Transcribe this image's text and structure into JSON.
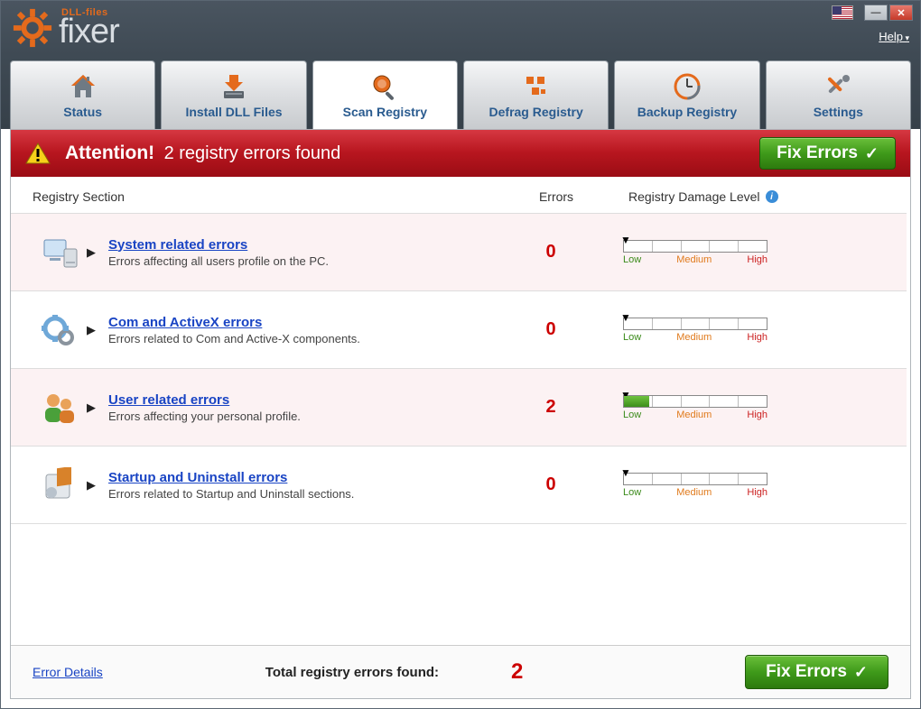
{
  "app": {
    "brand_small": "DLL-files",
    "brand": "fixer",
    "help": "Help"
  },
  "tabs": [
    {
      "label": "Status"
    },
    {
      "label": "Install DLL Files"
    },
    {
      "label": "Scan Registry"
    },
    {
      "label": "Defrag Registry"
    },
    {
      "label": "Backup Registry"
    },
    {
      "label": "Settings"
    }
  ],
  "alert": {
    "attention": "Attention!",
    "message": "2 registry errors found",
    "fix": "Fix Errors"
  },
  "headers": {
    "section": "Registry Section",
    "errors": "Errors",
    "damage": "Registry Damage Level"
  },
  "meter_labels": {
    "low": "Low",
    "med": "Medium",
    "high": "High"
  },
  "rows": [
    {
      "title": "System related errors",
      "desc": "Errors affecting all users profile on the PC.",
      "errors": "0",
      "fill_pct": 0,
      "tint": true
    },
    {
      "title": "Com and ActiveX errors",
      "desc": "Errors related to Com and Active-X components.",
      "errors": "0",
      "fill_pct": 0,
      "tint": false
    },
    {
      "title": "User related errors",
      "desc": "Errors affecting your personal profile.",
      "errors": "2",
      "fill_pct": 18,
      "tint": true
    },
    {
      "title": "Startup and Uninstall errors",
      "desc": "Errors related to Startup and Uninstall sections.",
      "errors": "0",
      "fill_pct": 0,
      "tint": false
    }
  ],
  "footer": {
    "details": "Error Details",
    "total_label": "Total registry errors found:",
    "total": "2",
    "fix": "Fix Errors"
  }
}
